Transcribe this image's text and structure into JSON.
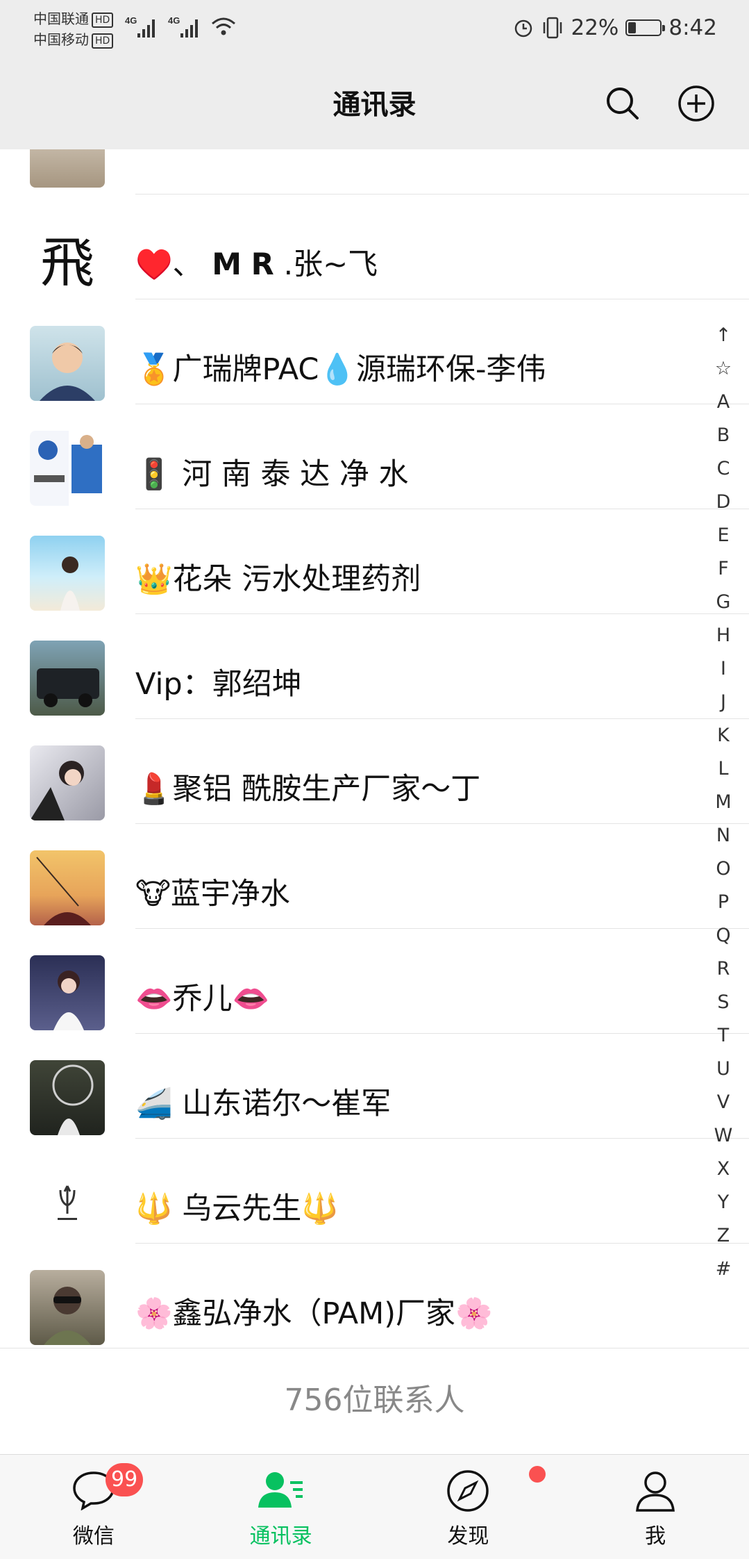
{
  "status_bar": {
    "carrier_1": "中国联通",
    "carrier_2": "中国移动",
    "hd_label": "HD",
    "network_1": "4G",
    "network_2": "4G",
    "battery_percent": "22%",
    "battery_level": 0.22,
    "time": "8:42"
  },
  "header": {
    "title": "通讯录",
    "search_icon": "search-icon",
    "add_icon": "plus-circle-icon"
  },
  "contacts": [
    {
      "name": "♥️、  𝗠 𝗥 .张~飞"
    },
    {
      "name": "🏅广瑞牌PAC💧源瑞环保-李伟"
    },
    {
      "name": "🚦 河 南 泰 达 净 水"
    },
    {
      "name": "👑花朵  污水处理药剂"
    },
    {
      "name": "Vip：郭绍坤"
    },
    {
      "name": "💄聚铝 酰胺生产厂家～丁"
    },
    {
      "name": "🐮蓝宇净水"
    },
    {
      "name": "👄乔儿👄"
    },
    {
      "name": "🚄 山东诺尔～崔军"
    },
    {
      "name": "🔱 乌云先生🔱"
    },
    {
      "name": "🌸鑫弘净水（PAM)厂家🌸"
    }
  ],
  "index_bar": [
    "↑",
    "☆",
    "A",
    "B",
    "C",
    "D",
    "E",
    "F",
    "G",
    "H",
    "I",
    "J",
    "K",
    "L",
    "M",
    "N",
    "O",
    "P",
    "Q",
    "R",
    "S",
    "T",
    "U",
    "V",
    "W",
    "X",
    "Y",
    "Z",
    "#"
  ],
  "footer": {
    "count_text": "756位联系人"
  },
  "tabbar": {
    "tabs": [
      {
        "label": "微信",
        "icon": "chat-icon",
        "badge": "99"
      },
      {
        "label": "通讯录",
        "icon": "contacts-icon",
        "active": true
      },
      {
        "label": "发现",
        "icon": "compass-icon"
      },
      {
        "label": "我",
        "icon": "person-icon"
      }
    ]
  },
  "colors": {
    "accent": "#07c160",
    "badge": "#fa5151",
    "header_bg": "#ededed"
  }
}
